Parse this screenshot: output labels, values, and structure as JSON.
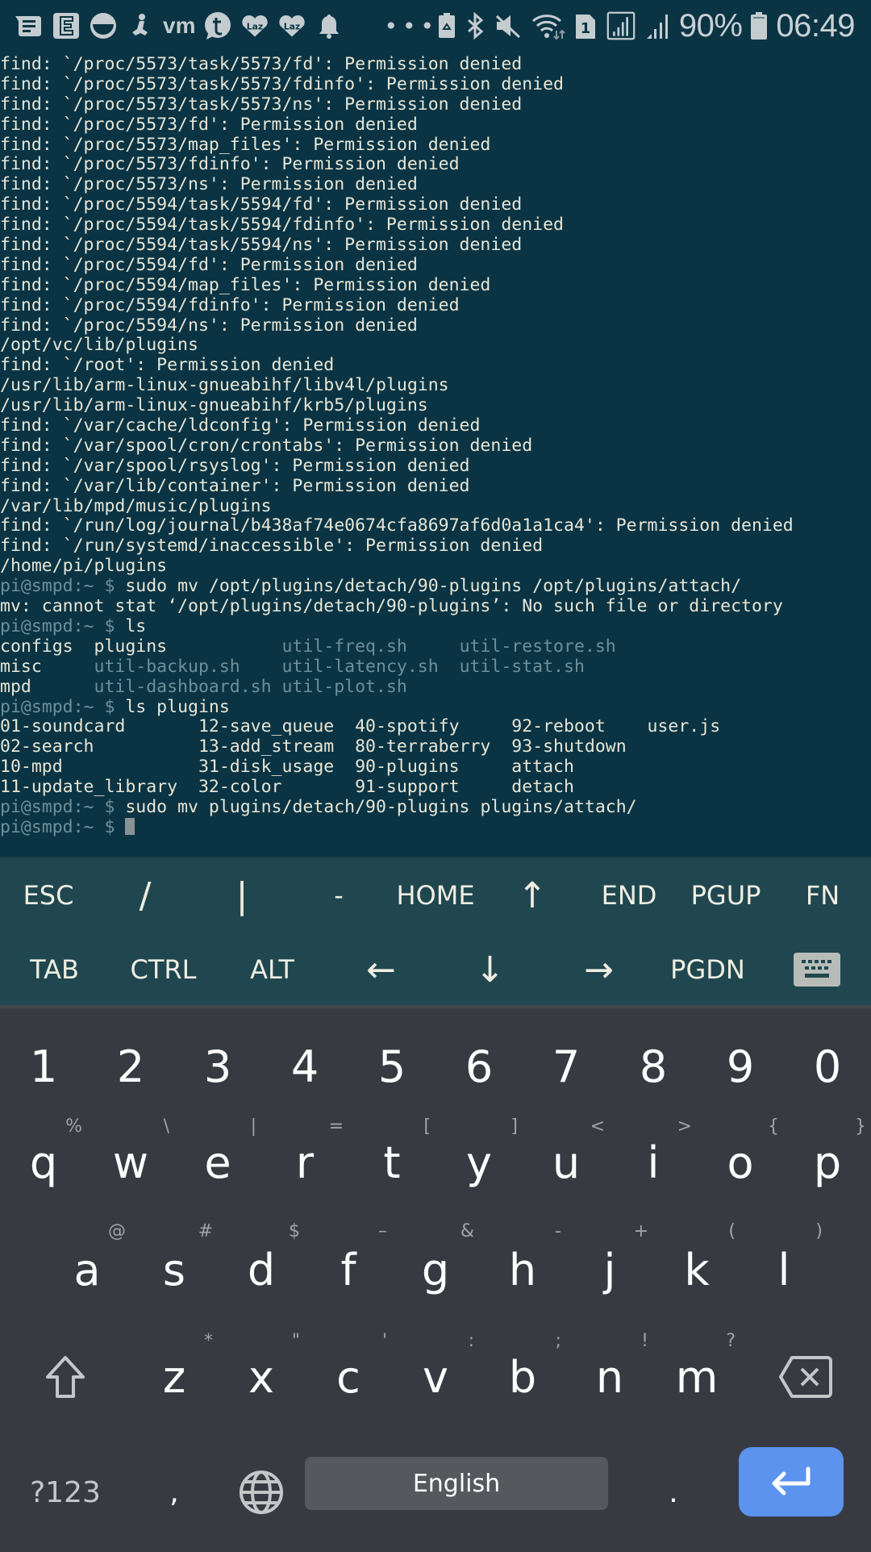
{
  "status_bar": {
    "left_icons": [
      "message-icon",
      "e-app-icon",
      "half-circle-icon",
      "anchor-person-icon",
      "vm-icon",
      "t-chat-icon",
      "lazada-icon",
      "lazada-icon",
      "bell-icon"
    ],
    "vm_label": "vm",
    "more": "•••",
    "right_icons": [
      "battery-saver-icon",
      "bluetooth-icon",
      "mute-icon",
      "wifi-icon",
      "sim1-icon",
      "signal-box-icon",
      "signal-icon"
    ],
    "sim_label": "1",
    "battery_percent": "90%",
    "time": "06:49"
  },
  "terminal": {
    "prompt": "pi@smpd",
    "prompt_suffix": ":~ $ ",
    "lines": [
      "find: `/proc/5573/task/5573/fd': Permission denied",
      "find: `/proc/5573/task/5573/fdinfo': Permission denied",
      "find: `/proc/5573/task/5573/ns': Permission denied",
      "find: `/proc/5573/fd': Permission denied",
      "find: `/proc/5573/map_files': Permission denied",
      "find: `/proc/5573/fdinfo': Permission denied",
      "find: `/proc/5573/ns': Permission denied",
      "find: `/proc/5594/task/5594/fd': Permission denied",
      "find: `/proc/5594/task/5594/fdinfo': Permission denied",
      "find: `/proc/5594/task/5594/ns': Permission denied",
      "find: `/proc/5594/fd': Permission denied",
      "find: `/proc/5594/map_files': Permission denied",
      "find: `/proc/5594/fdinfo': Permission denied",
      "find: `/proc/5594/ns': Permission denied",
      "/opt/vc/lib/plugins",
      "find: `/root': Permission denied",
      "/usr/lib/arm-linux-gnueabihf/libv4l/plugins",
      "/usr/lib/arm-linux-gnueabihf/krb5/plugins",
      "find: `/var/cache/ldconfig': Permission denied",
      "find: `/var/spool/cron/crontabs': Permission denied",
      "find: `/var/spool/rsyslog': Permission denied",
      "find: `/var/lib/container': Permission denied",
      "/var/lib/mpd/music/plugins",
      "find: `/run/log/journal/b438af74e0674cfa8697af6d0a1a1ca4': Permission denied",
      "find: `/run/systemd/inaccessible': Permission denied",
      "/home/pi/plugins"
    ],
    "cmd1": "sudo mv /opt/plugins/detach/90-plugins /opt/plugins/attach/",
    "cmd1_output": "mv: cannot stat ‘/opt/plugins/detach/90-plugins’: No such file or directory",
    "cmd2": "ls",
    "ls_output": [
      [
        {
          "t": "configs  ",
          "dim": false
        },
        {
          "t": "plugins           ",
          "dim": false
        },
        {
          "t": "util-freq.sh     ",
          "dim": true
        },
        {
          "t": "util-restore.sh",
          "dim": true
        }
      ],
      [
        {
          "t": "misc     ",
          "dim": false
        },
        {
          "t": "util-backup.sh    ",
          "dim": true
        },
        {
          "t": "util-latency.sh  ",
          "dim": true
        },
        {
          "t": "util-stat.sh",
          "dim": true
        }
      ],
      [
        {
          "t": "mpd      ",
          "dim": false
        },
        {
          "t": "util-dashboard.sh ",
          "dim": true
        },
        {
          "t": "util-plot.sh",
          "dim": true
        }
      ]
    ],
    "cmd3": "ls plugins",
    "ls_plugins_output": [
      "01-soundcard       12-save_queue  40-spotify     92-reboot    user.js",
      "02-search          13-add_stream  80-terraberry  93-shutdown",
      "10-mpd             31-disk_usage  90-plugins     attach",
      "11-update_library  32-color       91-support     detach"
    ],
    "cmd4": "sudo mv plugins/detach/90-plugins plugins/attach/",
    "current_input": ""
  },
  "extra_keys": {
    "row1": [
      "ESC",
      "/",
      "|",
      "-",
      "HOME",
      "↑",
      "END",
      "PGUP",
      "FN"
    ],
    "row2": [
      "TAB",
      "CTRL",
      "ALT",
      "←",
      "↓",
      "→",
      "PGDN"
    ],
    "keyboard_toggle_icon": "keyboard-icon"
  },
  "keyboard": {
    "number_row": [
      "1",
      "2",
      "3",
      "4",
      "5",
      "6",
      "7",
      "8",
      "9",
      "0"
    ],
    "row_q": [
      {
        "key": "q",
        "hint": "%"
      },
      {
        "key": "w",
        "hint": "\\"
      },
      {
        "key": "e",
        "hint": "|"
      },
      {
        "key": "r",
        "hint": "="
      },
      {
        "key": "t",
        "hint": "["
      },
      {
        "key": "y",
        "hint": "]"
      },
      {
        "key": "u",
        "hint": "<"
      },
      {
        "key": "i",
        "hint": ">"
      },
      {
        "key": "o",
        "hint": "{"
      },
      {
        "key": "p",
        "hint": "}"
      }
    ],
    "row_a": [
      {
        "key": "a",
        "hint": "@"
      },
      {
        "key": "s",
        "hint": "#"
      },
      {
        "key": "d",
        "hint": "$"
      },
      {
        "key": "f",
        "hint": "–"
      },
      {
        "key": "g",
        "hint": "&"
      },
      {
        "key": "h",
        "hint": "-"
      },
      {
        "key": "j",
        "hint": "+"
      },
      {
        "key": "k",
        "hint": "("
      },
      {
        "key": "l",
        "hint": ")"
      }
    ],
    "row_z": [
      {
        "key": "z",
        "hint": "*"
      },
      {
        "key": "x",
        "hint": "\""
      },
      {
        "key": "c",
        "hint": "'"
      },
      {
        "key": "v",
        "hint": ":"
      },
      {
        "key": "b",
        "hint": ";"
      },
      {
        "key": "n",
        "hint": "!"
      },
      {
        "key": "m",
        "hint": "?"
      }
    ],
    "symbols_label": "?123",
    "comma": ",",
    "space_label": "English",
    "period": ".",
    "enter_color": "#5b93ee"
  }
}
